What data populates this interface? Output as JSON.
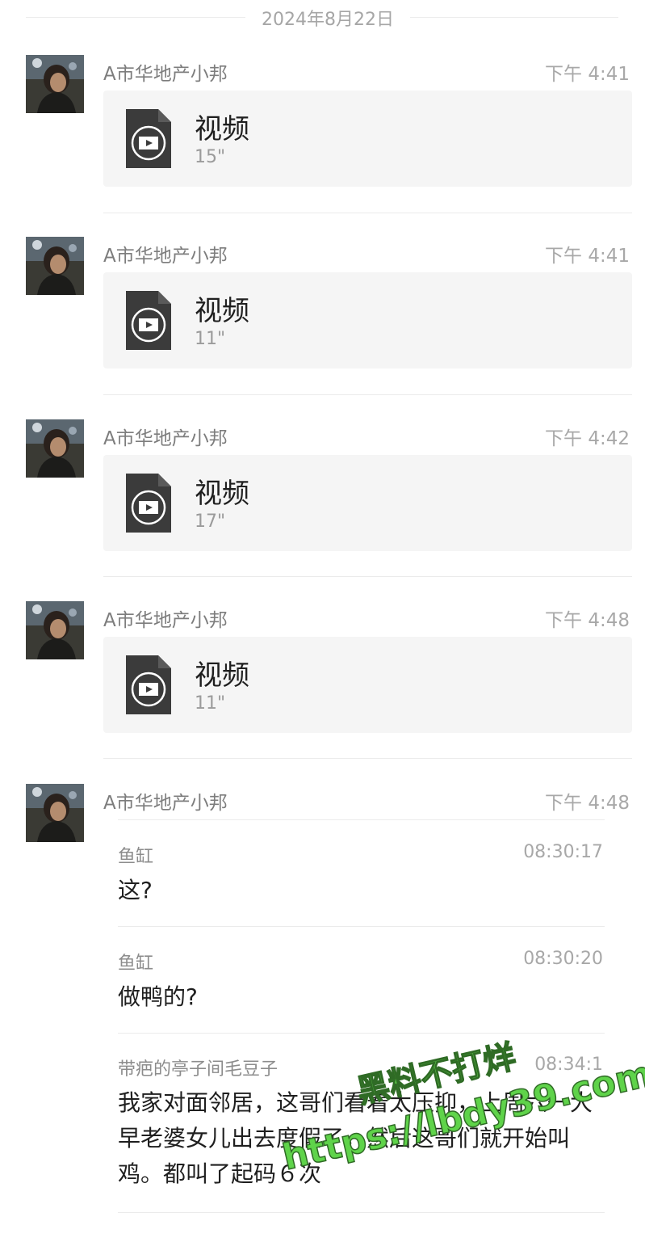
{
  "date_separator": "2024年8月22日",
  "messages": [
    {
      "sender": "A市华地产小邦",
      "time": "下午 4:41",
      "video": {
        "label": "视频",
        "duration": "15\""
      }
    },
    {
      "sender": "A市华地产小邦",
      "time": "下午 4:41",
      "video": {
        "label": "视频",
        "duration": "11\""
      }
    },
    {
      "sender": "A市华地产小邦",
      "time": "下午 4:42",
      "video": {
        "label": "视频",
        "duration": "17\""
      }
    },
    {
      "sender": "A市华地产小邦",
      "time": "下午 4:48",
      "video": {
        "label": "视频",
        "duration": "11\""
      }
    },
    {
      "sender": "A市华地产小邦",
      "time": "下午 4:48",
      "forwarded": [
        {
          "name": "鱼缸",
          "time": "08:30:17",
          "text": "这?"
        },
        {
          "name": "鱼缸",
          "time": "08:30:20",
          "text": "做鸭的?"
        },
        {
          "name": "带疤的亭子间毛豆子",
          "time": "08:34:1",
          "text": "我家对面邻居，这哥们看着太压抑，上周六一大早老婆女儿出去度假了，然后这哥们就开始叫鸡。都叫了起码６次"
        }
      ]
    }
  ],
  "watermark": {
    "line1": "黑料不打烊",
    "line2": "https://lbdy39.com"
  },
  "colors": {
    "card_bg": "#f5f5f5",
    "watermark_green": "#5fd34a"
  }
}
